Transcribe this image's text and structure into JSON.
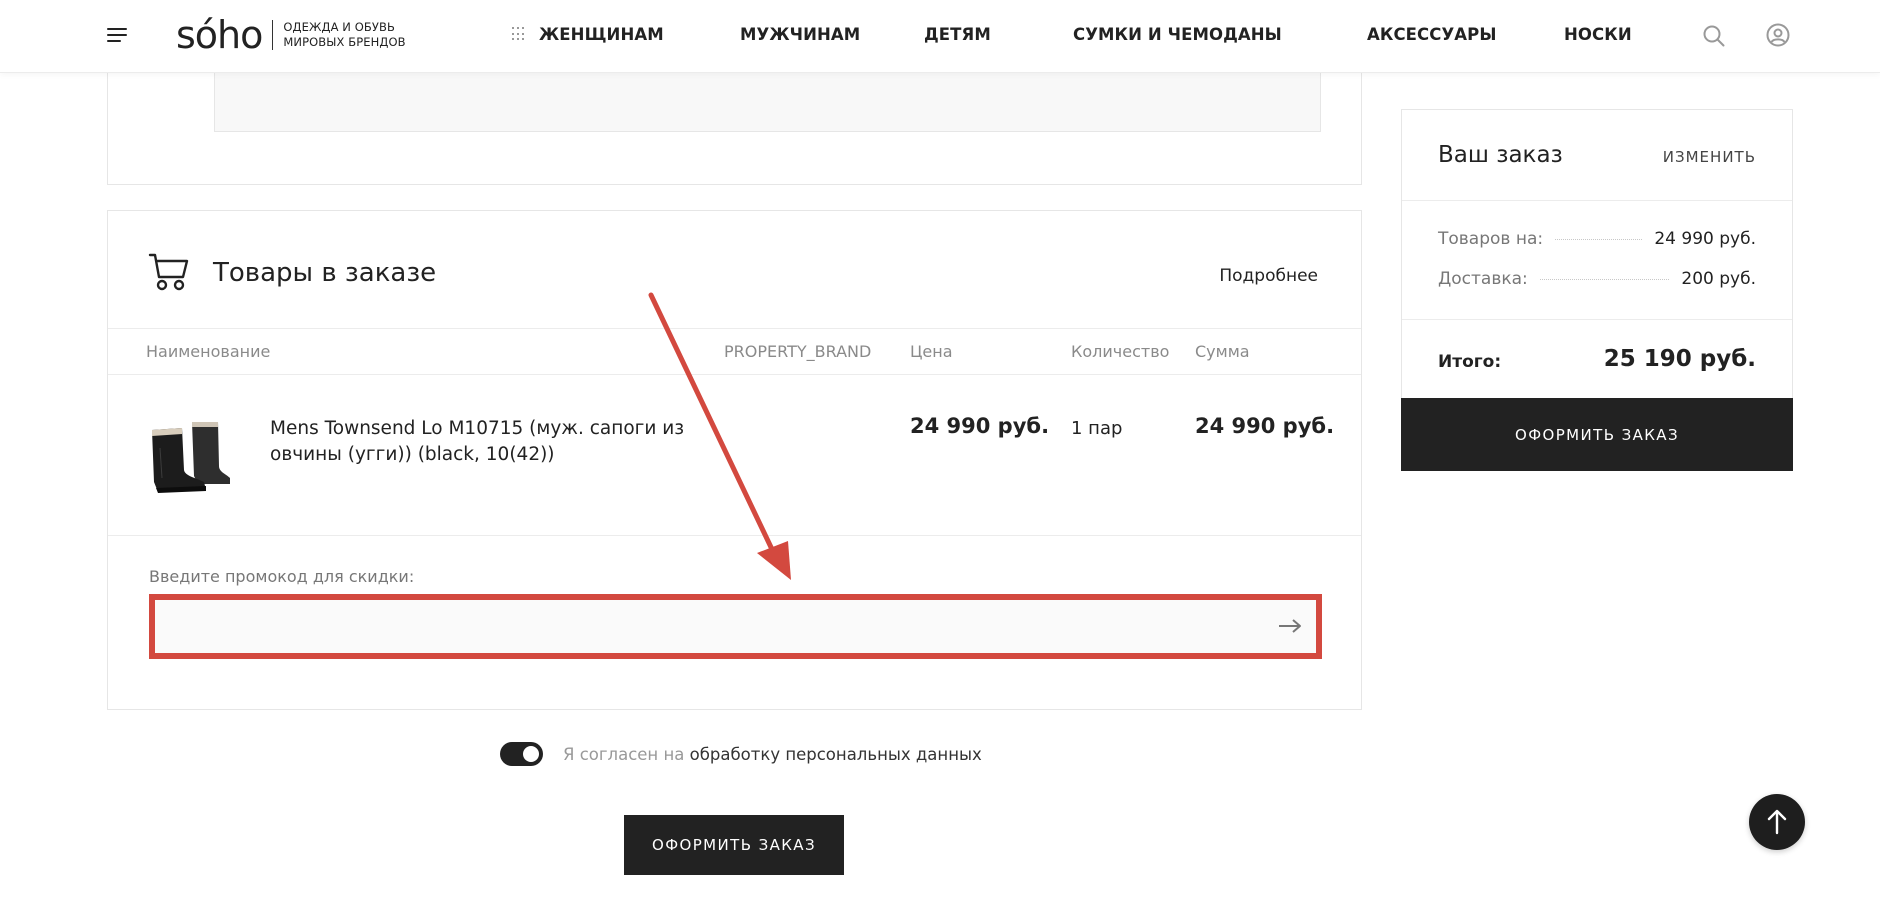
{
  "header": {
    "logo_text": "sóho",
    "tagline_line1": "ОДЕЖДА И ОБУВЬ",
    "tagline_line2": "МИРОВЫХ БРЕНДОВ",
    "nav": [
      "ЖЕНЩИНАМ",
      "МУЖЧИНАМ",
      "ДЕТЯМ",
      "СУМКИ И ЧЕМОДАНЫ",
      "АКСЕССУАРЫ",
      "НОСКИ"
    ]
  },
  "items_section": {
    "title": "Товары в заказе",
    "more_link": "Подробнее",
    "columns": [
      "Наименование",
      "PROPERTY_BRAND",
      "Цена",
      "Количество",
      "Сумма"
    ],
    "rows": [
      {
        "name": "Mens Townsend Lo M10715 (муж. сапоги из овчины (угги)) (black, 10(42))",
        "brand": "",
        "price": "24 990 руб.",
        "quantity": "1 пар",
        "sum": "24 990 руб."
      }
    ],
    "promo_label": "Введите промокод для скидки:",
    "promo_value": ""
  },
  "agreement": {
    "prefix": "Я согласен на ",
    "link": "обработку персональных данных",
    "checked": true
  },
  "submit_label": "ОФОРМИТЬ ЗАКАЗ",
  "summary": {
    "title": "Ваш заказ",
    "edit_label": "ИЗМЕНИТЬ",
    "goods_label": "Товаров на:",
    "goods_value": "24 990 руб.",
    "delivery_label": "Доставка:",
    "delivery_value": "200 руб.",
    "total_label": "Итого:",
    "total_value": "25 190 руб.",
    "button_label": "ОФОРМИТЬ ЗАКАЗ"
  },
  "icons": {
    "menu": "menu-icon",
    "nav_grid": "grid-icon",
    "search": "search-icon",
    "user": "user-icon",
    "cart": "cart-icon",
    "promo_submit": "arrow-right-icon",
    "scroll_top": "arrow-up-icon"
  },
  "colors": {
    "primary_dark": "#222222",
    "annotation_red": "#d3493f",
    "logo_accent": "#c9362f"
  }
}
